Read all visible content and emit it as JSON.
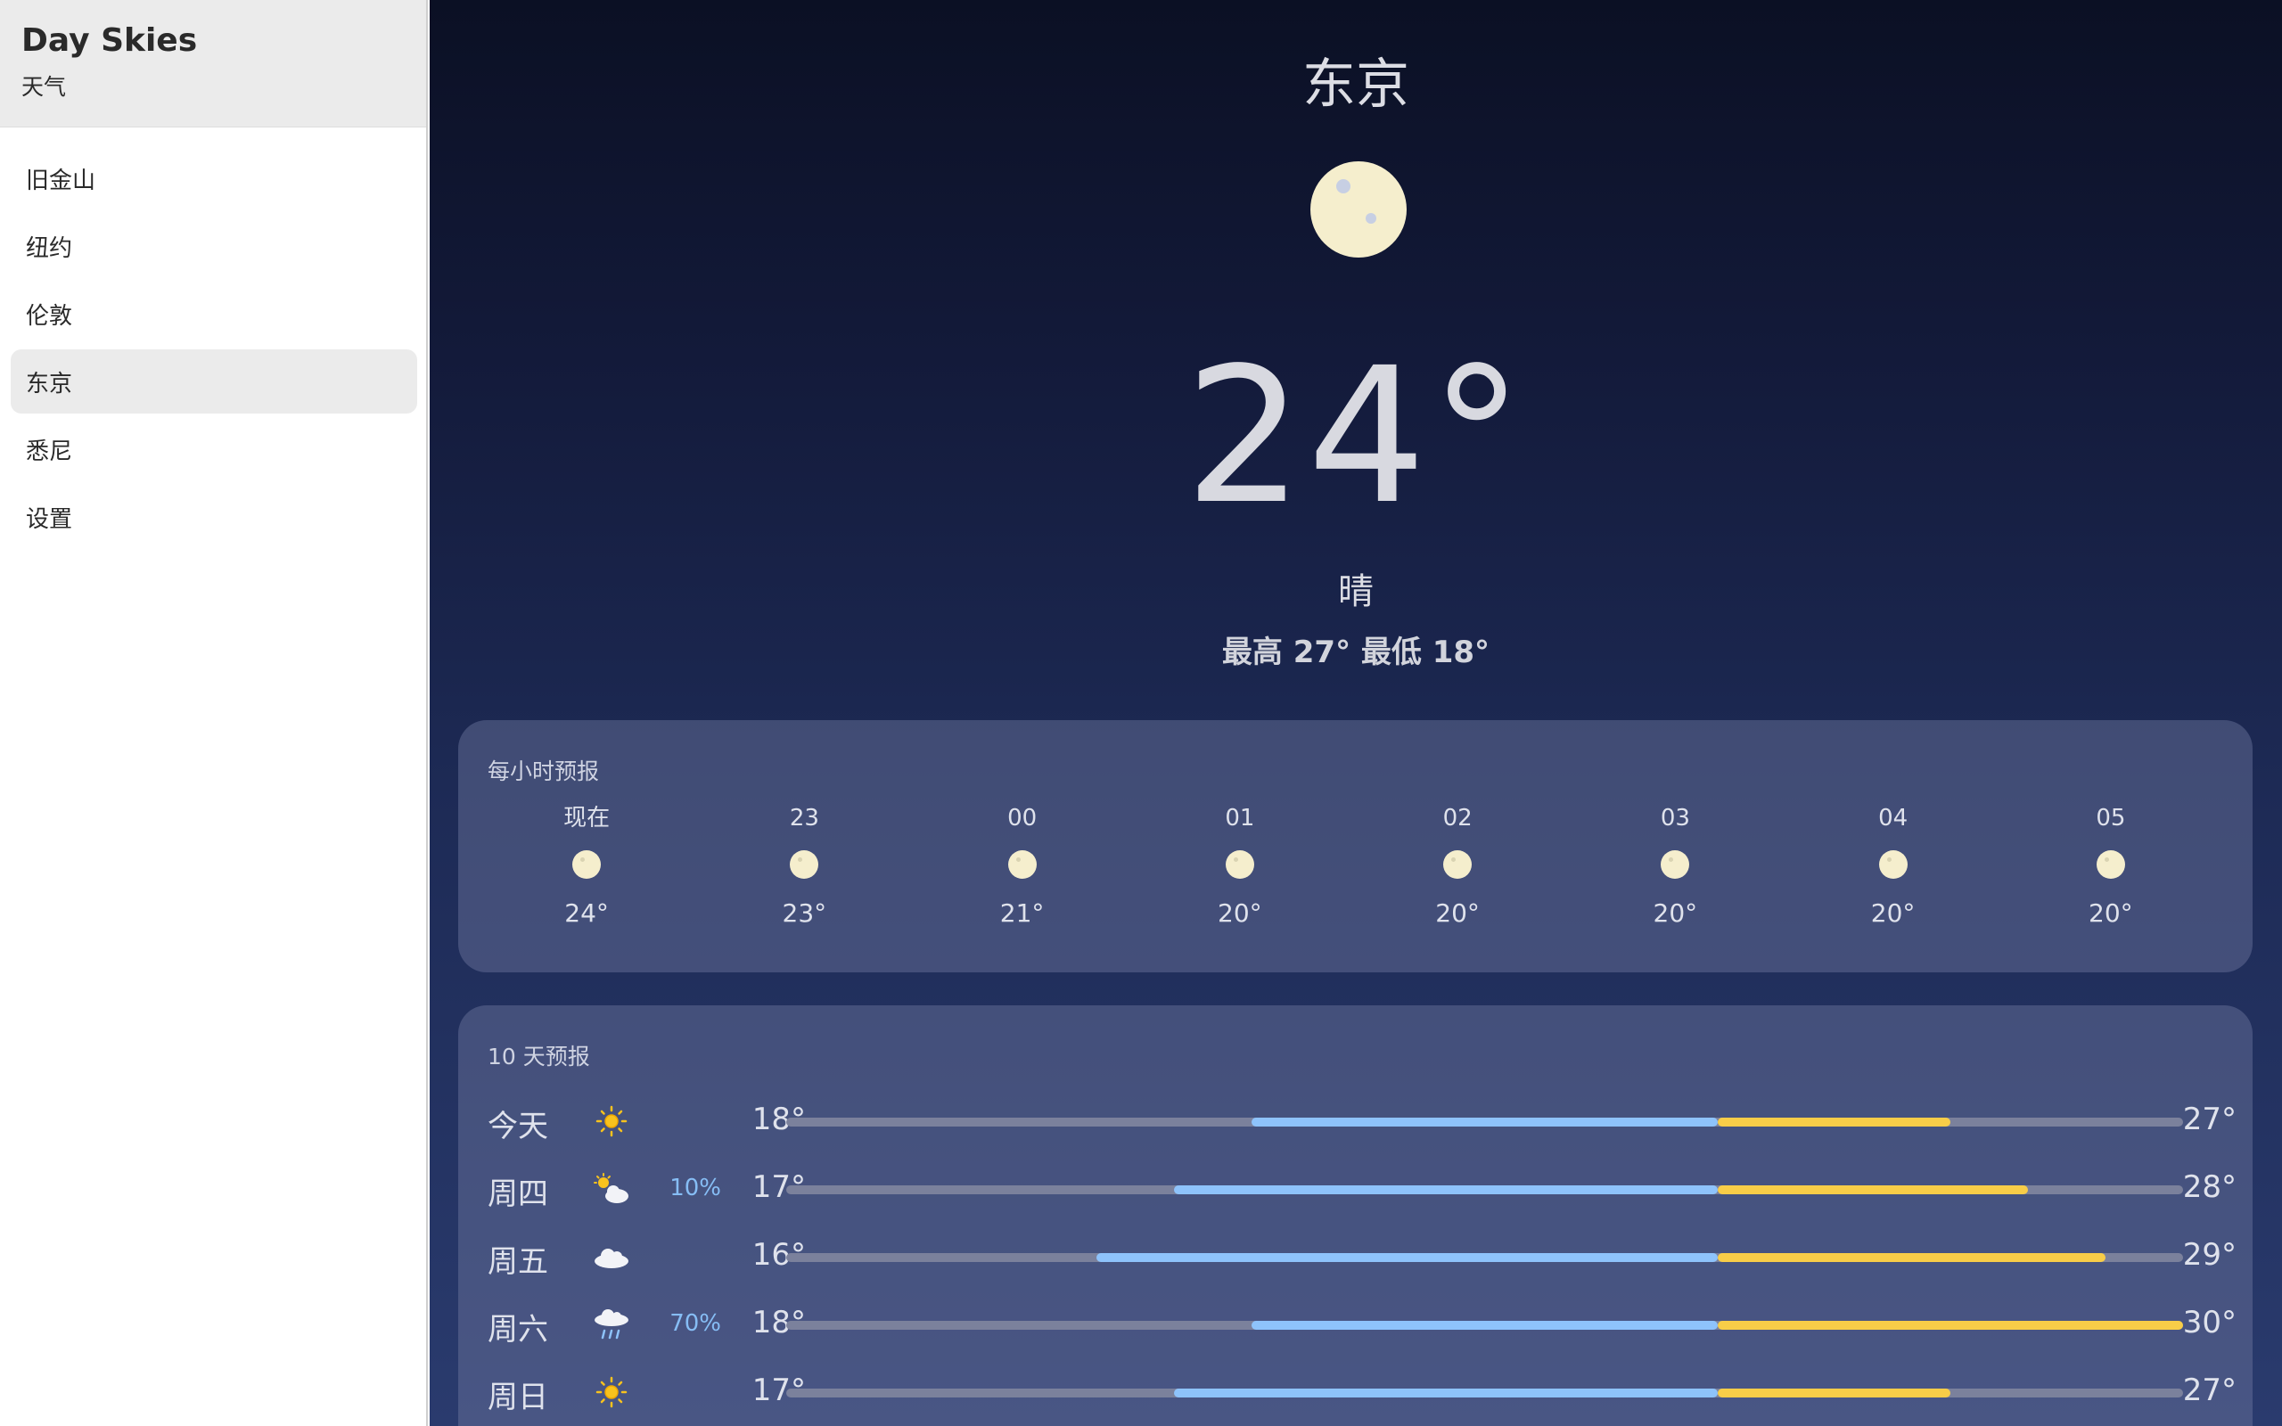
{
  "app": {
    "title": "Day Skies",
    "subtitle": "天气"
  },
  "sidebar": {
    "items": [
      {
        "label": "旧金山",
        "active": false
      },
      {
        "label": "纽约",
        "active": false
      },
      {
        "label": "伦敦",
        "active": false
      },
      {
        "label": "东京",
        "active": true
      },
      {
        "label": "悉尼",
        "active": false
      },
      {
        "label": "设置",
        "active": false
      }
    ]
  },
  "current": {
    "city": "东京",
    "icon": "moon-icon",
    "temperature": "24°",
    "condition": "晴",
    "high_low": "最高 27° 最低 18°"
  },
  "hourly": {
    "title": "每小时预报",
    "hours": [
      {
        "label": "现在",
        "icon": "moon-icon",
        "temp": "24°"
      },
      {
        "label": "23",
        "icon": "moon-icon",
        "temp": "23°"
      },
      {
        "label": "00",
        "icon": "moon-icon",
        "temp": "21°"
      },
      {
        "label": "01",
        "icon": "moon-icon",
        "temp": "20°"
      },
      {
        "label": "02",
        "icon": "moon-icon",
        "temp": "20°"
      },
      {
        "label": "03",
        "icon": "moon-icon",
        "temp": "20°"
      },
      {
        "label": "04",
        "icon": "moon-icon",
        "temp": "20°"
      },
      {
        "label": "05",
        "icon": "moon-icon",
        "temp": "20°"
      }
    ]
  },
  "daily": {
    "title": "10 天预报",
    "range_min": 12,
    "range_max": 30,
    "colors": {
      "cool": "#8ec3fb",
      "warm": "#f8cd48",
      "track": "#7b819c",
      "pop": "#86bdf5"
    },
    "days": [
      {
        "name": "今天",
        "icon": "sun-icon",
        "pop": "",
        "lo": 18,
        "hi": 27,
        "lo_label": "18°",
        "hi_label": "27°"
      },
      {
        "name": "周四",
        "icon": "partly-cloudy-icon",
        "pop": "10%",
        "lo": 17,
        "hi": 28,
        "lo_label": "17°",
        "hi_label": "28°"
      },
      {
        "name": "周五",
        "icon": "cloud-icon",
        "pop": "",
        "lo": 16,
        "hi": 29,
        "lo_label": "16°",
        "hi_label": "29°"
      },
      {
        "name": "周六",
        "icon": "rain-icon",
        "pop": "70%",
        "lo": 18,
        "hi": 30,
        "lo_label": "18°",
        "hi_label": "30°"
      },
      {
        "name": "周日",
        "icon": "sun-icon",
        "pop": "",
        "lo": 17,
        "hi": 27,
        "lo_label": "17°",
        "hi_label": "27°"
      }
    ]
  }
}
